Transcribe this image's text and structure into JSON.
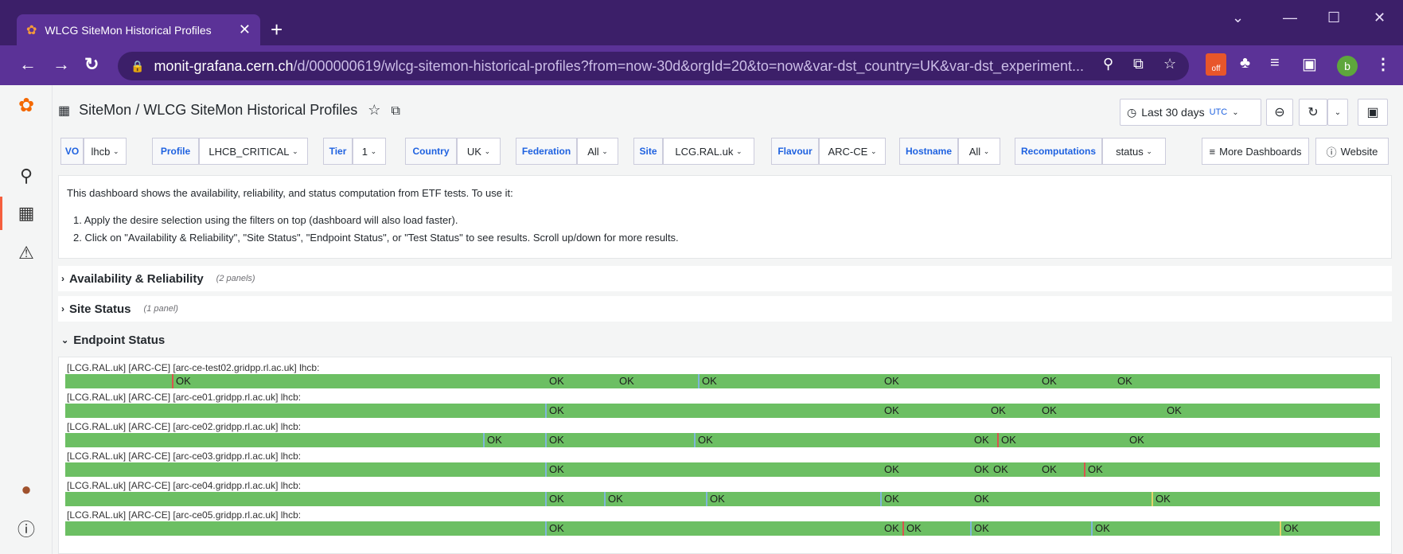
{
  "browser": {
    "tab_title": "WLCG SiteMon Historical Profiles",
    "url_host": "monit-grafana.cern.ch",
    "url_rest": "/d/000000619/wlcg-sitemon-historical-profiles?from=now-30d&orgId=20&to=now&var-dst_country=UK&var-dst_experiment...",
    "profile_initial": "b",
    "ext_badge": "off"
  },
  "header": {
    "breadcrumb_folder": "SiteMon",
    "breadcrumb_sep": " / ",
    "breadcrumb_title": "WLCG SiteMon Historical Profiles",
    "time_range": "Last 30 days",
    "timezone": "UTC"
  },
  "variables": [
    {
      "label": "VO",
      "value": "lhcb"
    },
    {
      "label": "Profile",
      "value": "LHCB_CRITICAL"
    },
    {
      "label": "Tier",
      "value": "1"
    },
    {
      "label": "Country",
      "value": "UK"
    },
    {
      "label": "Federation",
      "value": "All"
    },
    {
      "label": "Site",
      "value": "LCG.RAL.uk"
    },
    {
      "label": "Flavour",
      "value": "ARC-CE"
    },
    {
      "label": "Hostname",
      "value": "All"
    },
    {
      "label": "Recomputations",
      "value": "status"
    }
  ],
  "links": {
    "more_dashboards": "More Dashboards",
    "website": "Website"
  },
  "text_panel": {
    "intro": "This dashboard shows the availability, reliability, and status computation from ETF tests. To use it:",
    "step1": "1. Apply the desire selection using the filters on top (dashboard will also load faster).",
    "step2": "2. Click on \"Availability & Reliability\", \"Site Status\", \"Endpoint Status\", or \"Test Status\" to see results. Scroll up/down for more results."
  },
  "rows": [
    {
      "title": "Availability & Reliability",
      "count": "(2 panels)",
      "collapsed": true
    },
    {
      "title": "Site Status",
      "count": "(1 panel)",
      "collapsed": true
    },
    {
      "title": "Endpoint Status",
      "count": "",
      "collapsed": false
    }
  ],
  "endpoint_status": {
    "bar_color": "#6cbf63",
    "endpoints": [
      {
        "label": "[LCG.RAL.uk] [ARC-CE] [arc-ce-test02.gridpp.rl.ac.uk] lhcb:",
        "segments": [
          {
            "text": "OK",
            "start": 0.081,
            "edge": "red"
          },
          {
            "text": "OK",
            "start": 0.365,
            "edge": "green"
          },
          {
            "text": "OK",
            "start": 0.418,
            "edge": "green"
          },
          {
            "text": "OK",
            "start": 0.481,
            "edge": "blue"
          },
          {
            "text": "OK",
            "start": 0.62,
            "edge": "green"
          },
          {
            "text": "OK",
            "start": 0.74,
            "edge": "green"
          },
          {
            "text": "OK",
            "start": 0.797,
            "edge": "green"
          }
        ]
      },
      {
        "label": "[LCG.RAL.uk] [ARC-CE] [arc-ce01.gridpp.rl.ac.uk] lhcb:",
        "segments": [
          {
            "text": "OK",
            "start": 0.365,
            "edge": "blue"
          },
          {
            "text": "OK",
            "start": 0.62,
            "edge": "green"
          },
          {
            "text": "OK",
            "start": 0.701,
            "edge": "green"
          },
          {
            "text": "OK",
            "start": 0.74,
            "edge": "green"
          },
          {
            "text": "OK",
            "start": 0.835,
            "edge": "green"
          }
        ]
      },
      {
        "label": "[LCG.RAL.uk] [ARC-CE] [arc-ce02.gridpp.rl.ac.uk] lhcb:",
        "segments": [
          {
            "text": "OK",
            "start": 0.318,
            "edge": "blue"
          },
          {
            "text": "OK",
            "start": 0.365,
            "edge": "blue"
          },
          {
            "text": "OK",
            "start": 0.478,
            "edge": "blue"
          },
          {
            "text": "OK",
            "start": 0.688,
            "edge": "green"
          },
          {
            "text": "OK",
            "start": 0.709,
            "edge": "red"
          },
          {
            "text": "OK",
            "start": 0.806,
            "edge": "green"
          }
        ]
      },
      {
        "label": "[LCG.RAL.uk] [ARC-CE] [arc-ce03.gridpp.rl.ac.uk] lhcb:",
        "segments": [
          {
            "text": "OK",
            "start": 0.365,
            "edge": "blue"
          },
          {
            "text": "OK",
            "start": 0.62,
            "edge": "green"
          },
          {
            "text": "OK",
            "start": 0.688,
            "edge": "green"
          },
          {
            "text": "OK",
            "start": 0.703,
            "edge": "green"
          },
          {
            "text": "OK",
            "start": 0.74,
            "edge": "green"
          },
          {
            "text": "OK",
            "start": 0.775,
            "edge": "red"
          }
        ]
      },
      {
        "label": "[LCG.RAL.uk] [ARC-CE] [arc-ce04.gridpp.rl.ac.uk] lhcb:",
        "segments": [
          {
            "text": "OK",
            "start": 0.365,
            "edge": "blue"
          },
          {
            "text": "OK",
            "start": 0.41,
            "edge": "blue"
          },
          {
            "text": "OK",
            "start": 0.487,
            "edge": "blue"
          },
          {
            "text": "OK",
            "start": 0.62,
            "edge": "blue"
          },
          {
            "text": "OK",
            "start": 0.688,
            "edge": "green"
          },
          {
            "text": "OK",
            "start": 0.826,
            "edge": "yellow"
          }
        ]
      },
      {
        "label": "[LCG.RAL.uk] [ARC-CE] [arc-ce05.gridpp.rl.ac.uk] lhcb:",
        "segments": [
          {
            "text": "OK",
            "start": 0.365,
            "edge": "blue"
          },
          {
            "text": "OK",
            "start": 0.62,
            "edge": "green"
          },
          {
            "text": "OK",
            "start": 0.637,
            "edge": "red"
          },
          {
            "text": "OK",
            "start": 0.688,
            "edge": "blue"
          },
          {
            "text": "OK",
            "start": 0.78,
            "edge": "blue"
          },
          {
            "text": "OK",
            "start": 0.924,
            "edge": "yellow"
          }
        ]
      }
    ]
  }
}
